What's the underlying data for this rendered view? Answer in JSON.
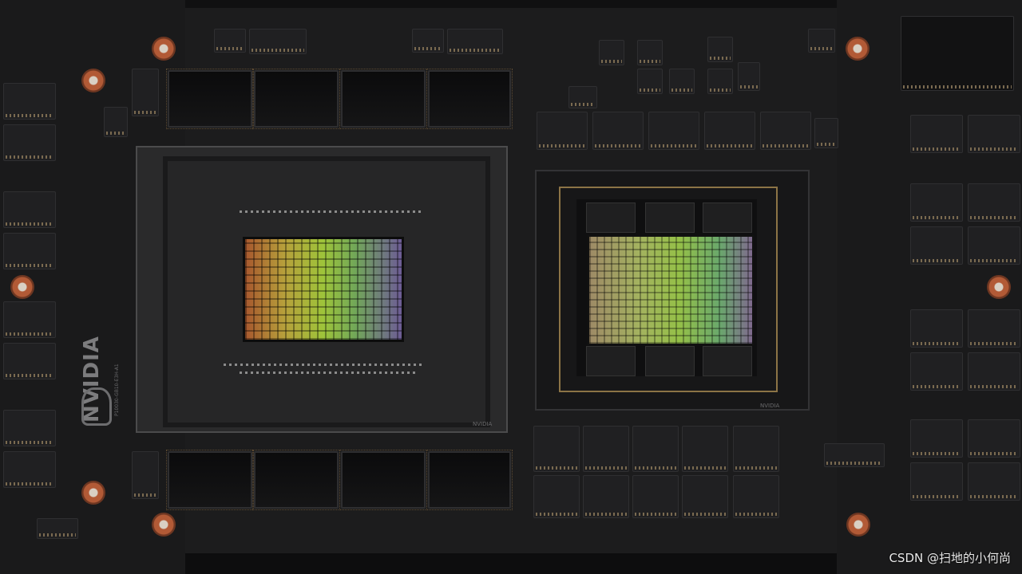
{
  "photo": {
    "subject": "GPU module board",
    "brand_text": "NVIDIA",
    "gpu_part_number": "P10030-GB10-E3H-A1",
    "gpu_logo_text": "NVIDIA",
    "cpu_logo_text": "NVIDIA",
    "watermark": "CSDN @扫地的小何尚",
    "board_color": "#1c1c1d",
    "mount_hole_color": "#b25a36"
  }
}
